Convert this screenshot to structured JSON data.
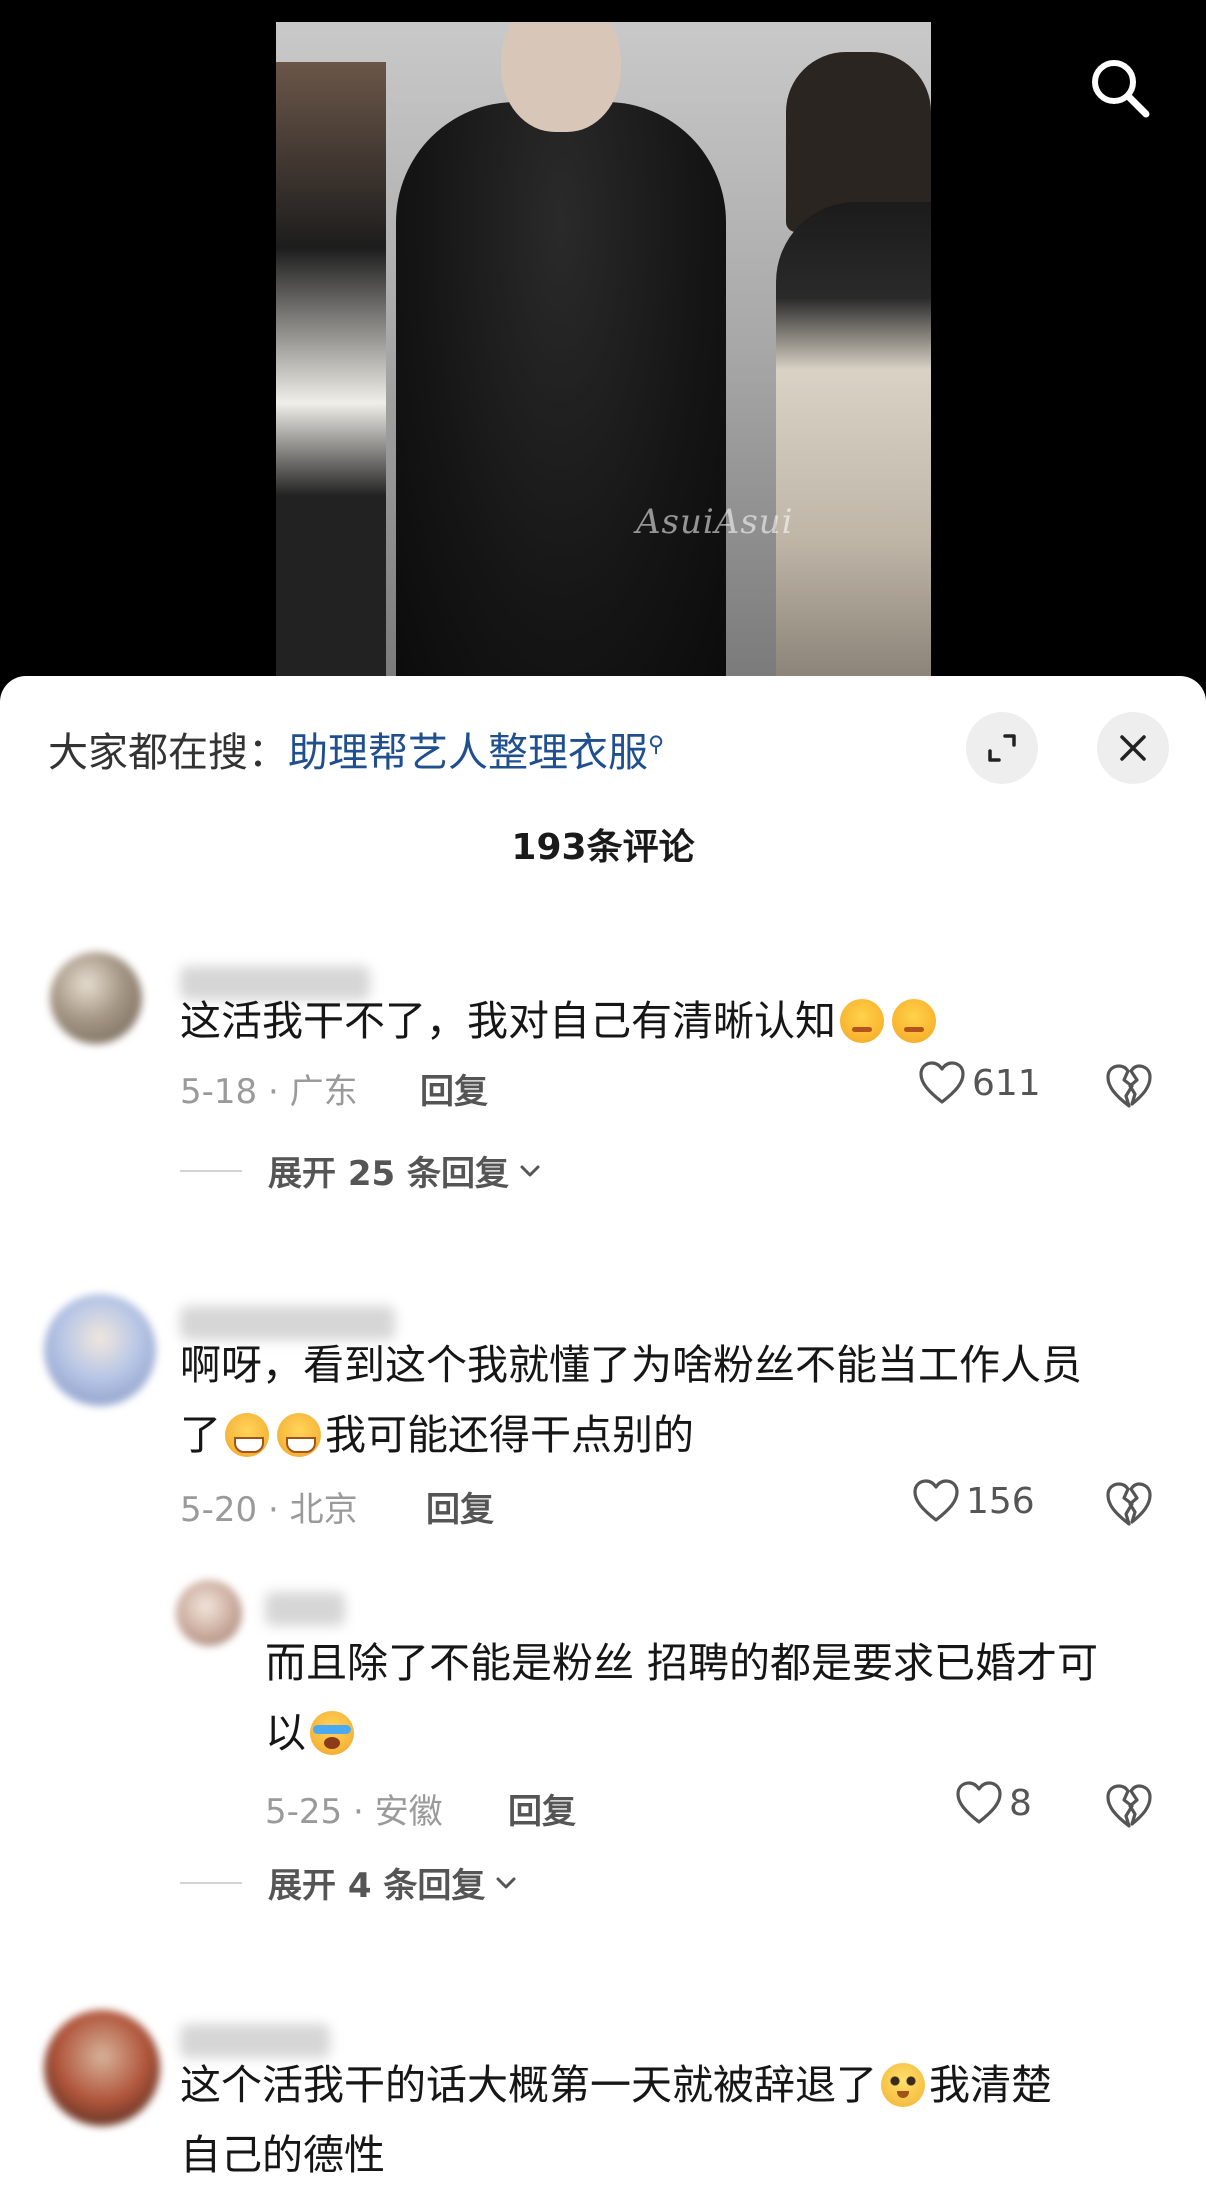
{
  "video": {
    "watermark": "AsuiAsui",
    "search_icon": "search-icon"
  },
  "sheet": {
    "search_prefix": "大家都在搜：",
    "search_keyword": "助理帮艺人整理衣服",
    "comment_count": "193条评论",
    "expand_icon": "expand-icon",
    "close_icon": "close-icon"
  },
  "comments": [
    {
      "text": "这活我干不了，我对自己有清晰认知",
      "emojis": [
        "smug",
        "smug"
      ],
      "date_location": "5-18 · 广东",
      "reply_label": "回复",
      "likes": "611",
      "expand_label": "展开 25 条回复"
    },
    {
      "text_line1": "啊呀，看到这个我就懂了为啥粉丝不能当工作人员",
      "text_line2_prefix": "了",
      "text_line2_suffix": "我可能还得干点别的",
      "emojis": [
        "grin",
        "grin"
      ],
      "date_location": "5-20 · 北京",
      "reply_label": "回复",
      "likes": "156"
    },
    {
      "text_line1": "而且除了不能是粉丝 招聘的都是要求已婚才可",
      "text_line2": "以",
      "emojis": [
        "cry"
      ],
      "date_location": "5-25 · 安徽",
      "reply_label": "回复",
      "likes": "8",
      "expand_label": "展开 4 条回复"
    },
    {
      "text_line1": "这个活我干的话大概第一天就被辞退了",
      "text_line1_suffix": "我清楚",
      "text_line2": "自己的德性",
      "emojis": [
        "blush"
      ]
    }
  ]
}
